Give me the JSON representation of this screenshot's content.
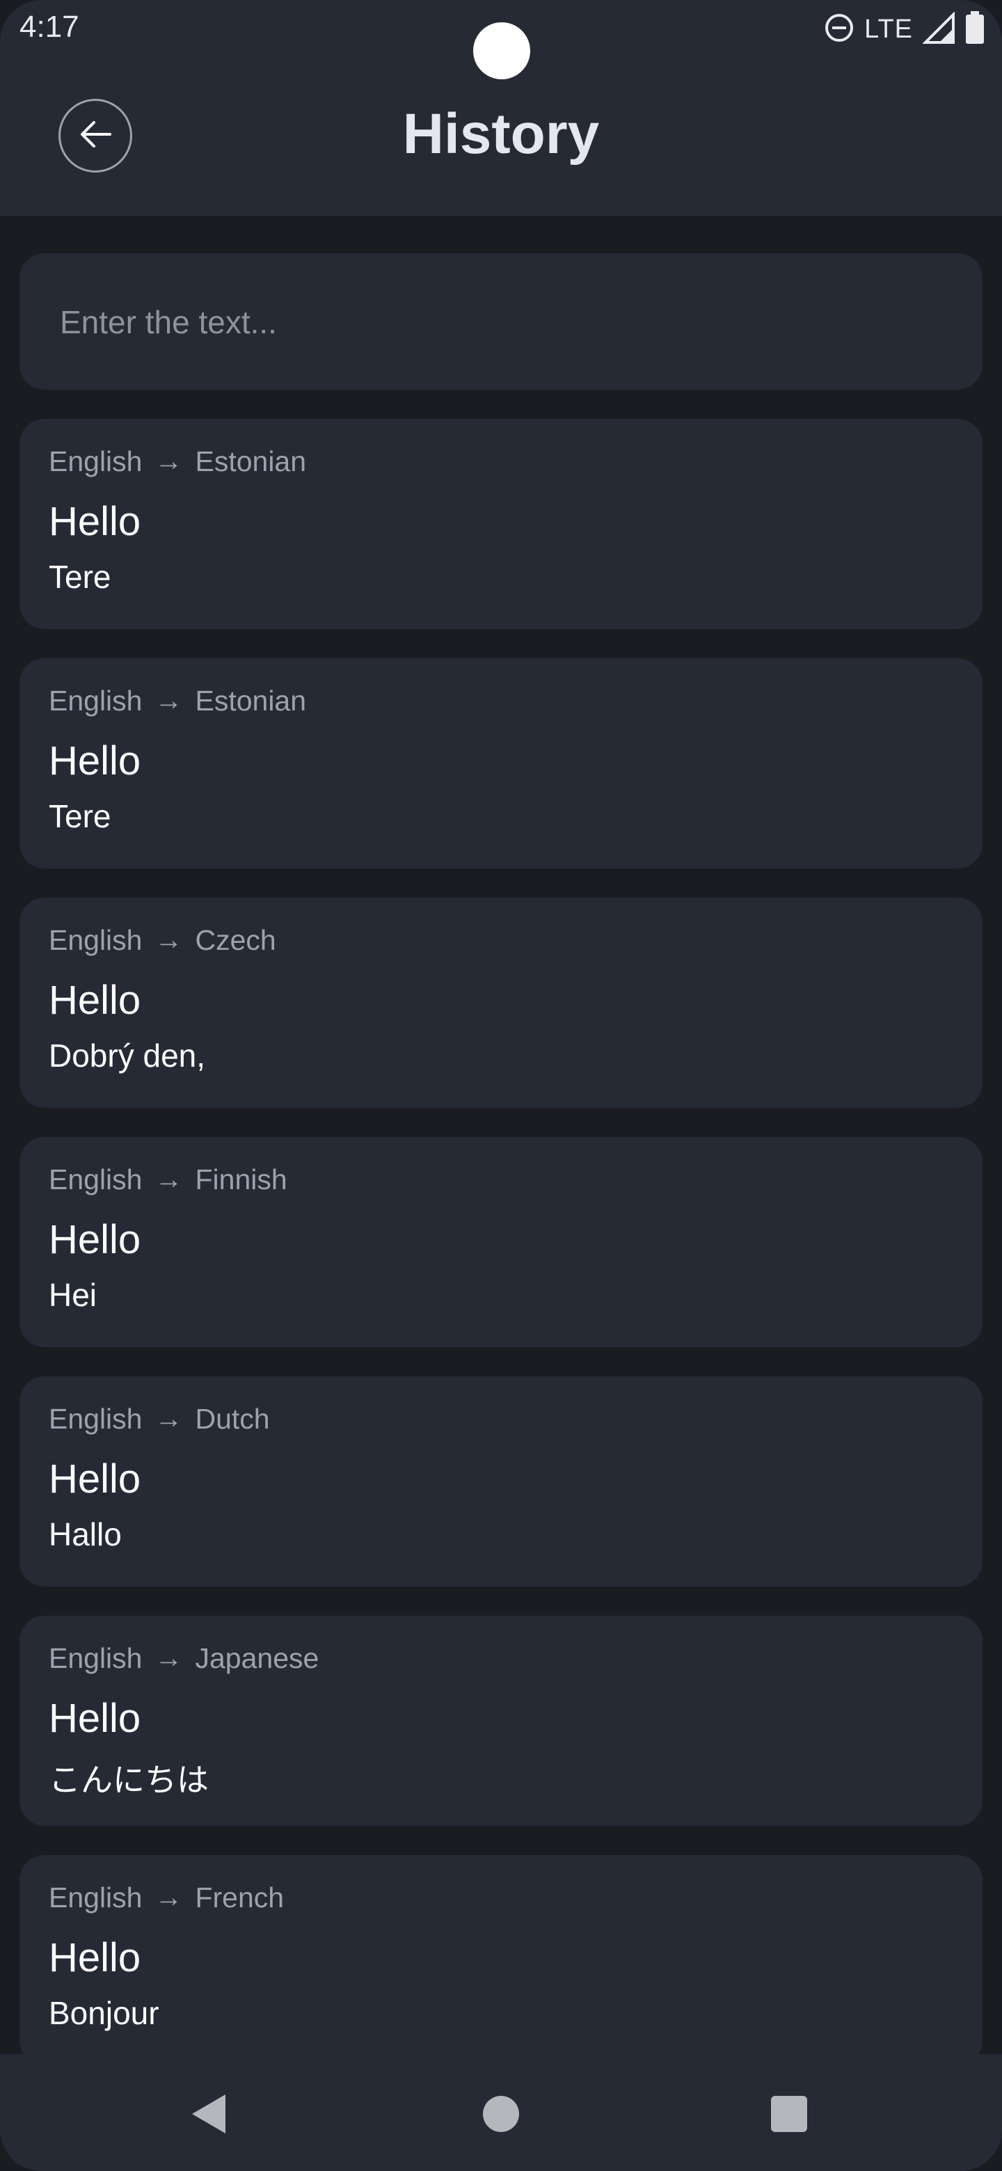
{
  "status_bar": {
    "time": "4:17",
    "network": "LTE",
    "icons": [
      "do-not-disturb-icon",
      "signal-icon",
      "battery-icon"
    ]
  },
  "app_bar": {
    "title": "History",
    "back_icon": "arrow-left-icon"
  },
  "search": {
    "placeholder": "Enter the text...",
    "value": ""
  },
  "history": [
    {
      "source_lang": "English",
      "target_lang": "Estonian",
      "source_text": "Hello",
      "translation": "Tere"
    },
    {
      "source_lang": "English",
      "target_lang": "Estonian",
      "source_text": "Hello",
      "translation": "Tere"
    },
    {
      "source_lang": "English",
      "target_lang": "Czech",
      "source_text": "Hello",
      "translation": "Dobrý den,"
    },
    {
      "source_lang": "English",
      "target_lang": "Finnish",
      "source_text": "Hello",
      "translation": "Hei"
    },
    {
      "source_lang": "English",
      "target_lang": "Dutch",
      "source_text": "Hello",
      "translation": "Hallo"
    },
    {
      "source_lang": "English",
      "target_lang": "Japanese",
      "source_text": "Hello",
      "translation": "こんにちは"
    },
    {
      "source_lang": "English",
      "target_lang": "French",
      "source_text": "Hello",
      "translation": "Bonjour"
    }
  ],
  "nav_bar": {
    "icons": [
      "nav-back-icon",
      "nav-home-icon",
      "nav-recents-icon"
    ]
  },
  "colors": {
    "background": "#1b1c22",
    "surface": "#262a35",
    "muted_text": "#9ea2ad",
    "primary_text": "#ffffff"
  }
}
